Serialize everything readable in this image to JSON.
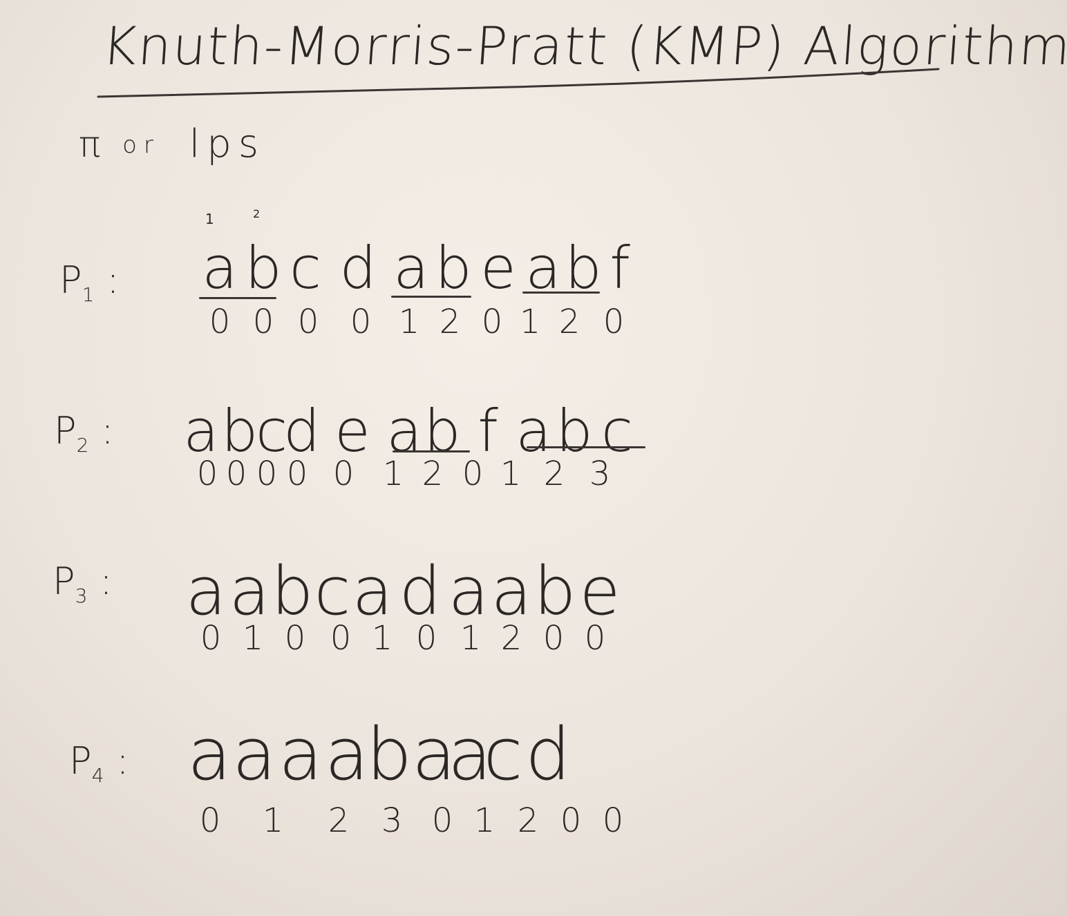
{
  "title": "Knuth-Morris-Pratt (KMP) Algorithm",
  "subtitle": {
    "symbol": "π",
    "conj": "or",
    "term": "lps"
  },
  "index_marks": [
    "1",
    "2"
  ],
  "patterns": [
    {
      "label": "P",
      "sub": "1",
      "chars": [
        "a",
        "b",
        "c",
        "d",
        "a",
        "b",
        "e",
        "a",
        "b",
        "f"
      ],
      "values": [
        "0",
        "0",
        "0",
        "0",
        "1",
        "2",
        "0",
        "1",
        "2",
        "0"
      ]
    },
    {
      "label": "P",
      "sub": "2",
      "chars": [
        "a",
        "b",
        "c",
        "d",
        "e",
        "a",
        "b",
        "f",
        "a",
        "b",
        "c"
      ],
      "values": [
        "0",
        "0",
        "0",
        "0",
        "0",
        "1",
        "2",
        "0",
        "1",
        "2",
        "3"
      ]
    },
    {
      "label": "P",
      "sub": "3",
      "chars": [
        "a",
        "a",
        "b",
        "c",
        "a",
        "d",
        "a",
        "a",
        "b",
        "e"
      ],
      "values": [
        "0",
        "1",
        "0",
        "0",
        "1",
        "0",
        "1",
        "2",
        "0",
        "0"
      ]
    },
    {
      "label": "P",
      "sub": "4",
      "chars": [
        "a",
        "a",
        "a",
        "a",
        "b",
        "a",
        "a",
        "c",
        "d"
      ],
      "values": [
        "0",
        "1",
        "2",
        "3",
        "0",
        "1",
        "2",
        "0",
        "0"
      ]
    }
  ],
  "colon": ":"
}
